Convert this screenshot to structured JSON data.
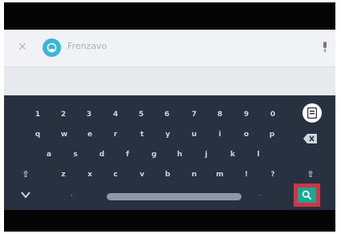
{
  "search": {
    "query": "Frenzavo",
    "back_icon": "back-arrow-icon",
    "app_icon": "search-app-icon",
    "mic_icon": "microphone-icon"
  },
  "keyboard": {
    "rows": [
      [
        "1",
        "2",
        "3",
        "4",
        "5",
        "6",
        "7",
        "8",
        "9",
        "0"
      ],
      [
        "q",
        "w",
        "e",
        "r",
        "t",
        "y",
        "u",
        "i",
        "o",
        "p"
      ],
      [
        "a",
        "s",
        "d",
        "f",
        "g",
        "h",
        "j",
        "k",
        "l"
      ],
      [
        "z",
        "x",
        "c",
        "v",
        "b",
        "n",
        "m",
        "!",
        "?"
      ]
    ],
    "shift_symbol": "⇧",
    "comma": ",",
    "period": ".",
    "emoji_icon": "emoji-icon",
    "backspace_icon": "backspace-icon",
    "search_icon": "search-icon",
    "hide_icon": "chevron-down-icon"
  },
  "colors": {
    "keyboard_bg": "#273140",
    "accent": "#17a890",
    "highlight": "#d23347"
  }
}
